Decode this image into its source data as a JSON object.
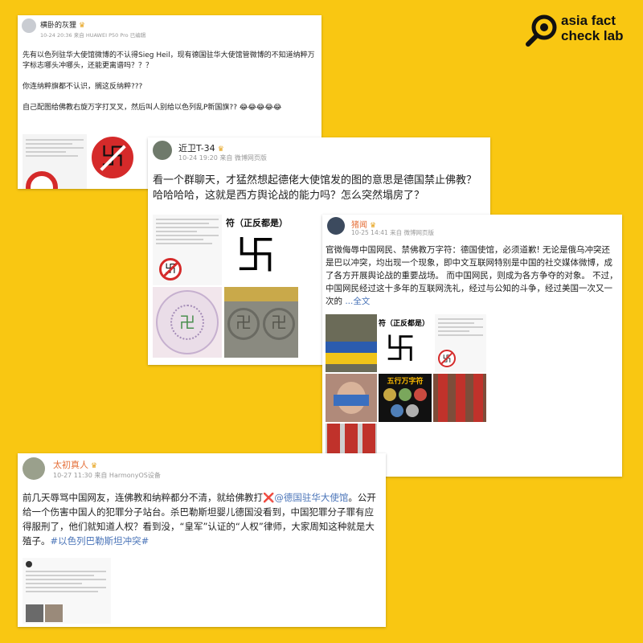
{
  "brand": {
    "line1": "asia fact",
    "line2": "check lab"
  },
  "posts": [
    {
      "user": "横卧的灰狸",
      "meta": "10-24 20:36 来自 HUAWEI P50 Pro 已编辑",
      "p1": "先有以色列驻华大使馆微博的不认得Sieg Heil，现有德国驻华大使馆管微博的不知道纳粹万字标志哪头冲哪头，还能更离谱吗？？？",
      "p2": "你连纳粹旗都不认识，搁这反纳粹???",
      "p3": "自己配图给佛教右旋万字打叉叉，然后叫人别给以色列乱P新国旗?? 😂😂😂😂😂"
    },
    {
      "user": "近卫T-34",
      "meta": "10-24 19:20 来自 微博网页版",
      "text": "看一个群聊天，才猛然想起德佬大使馆发的图的意思是德国禁止佛教？哈哈哈哈，这就是西方舆论战的能力吗？怎么突然塌房了？",
      "img_label": "符（正反都是）"
    },
    {
      "user": "猪闻",
      "meta": "10-25 14:41 来自 微博网页版",
      "text": "官微侮辱中国网民、禁佛教万字符：德国使馆，必须道歉! 无论是俄乌冲突还是巴以冲突，均出现一个现象，即中文互联网特别是中国的社交媒体微博，成了各方开展舆论战的重要战场。 而中国网民，则成为各方争夺的对象。 不过，中国网民经过这十多年的互联网洗礼，经过与公知的斗争，经过美国一次又一次的 ",
      "more": "...全文",
      "img_label": "符（正反都是）",
      "img_label2": "五行万字符"
    },
    {
      "user": "太初真人",
      "meta": "10-27 11:30 来自 HarmonyOS设备",
      "t1": "前几天辱骂中国网友，连佛教和纳粹都分不清，就给佛教打",
      "cross": "❌",
      "mention": "@德国驻华大使馆",
      "t2": "。公开给一个伤害中国人的犯罪分子站台。杀巴勒斯坦婴儿德国没看到，中国犯罪分子罪有应得服刑了，他们就知道人权？看到没，“皇军”认证的“人权”律师，大家周知这种就是大殖子。",
      "tag": "#以色列巴勒斯坦冲突#"
    }
  ]
}
